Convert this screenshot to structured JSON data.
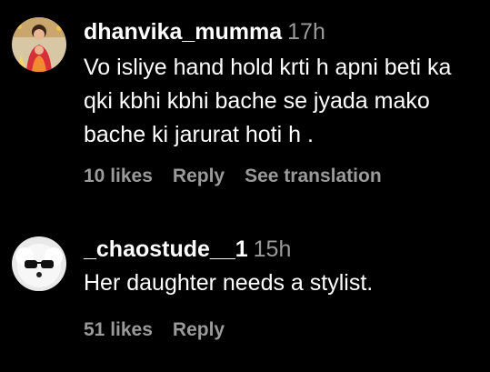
{
  "comments": [
    {
      "username": "dhanvika_mumma",
      "time": "17h",
      "text": "Vo isliye hand hold krti h apni beti ka qki kbhi kbhi bache se jyada mako bache ki jarurat hoti h .",
      "likes": "10 likes",
      "reply": "Reply",
      "translate": "See translation"
    },
    {
      "username": "_chaostude__1",
      "time": "15h",
      "text": "Her daughter needs a stylist.",
      "likes": "51 likes",
      "reply": "Reply"
    }
  ]
}
